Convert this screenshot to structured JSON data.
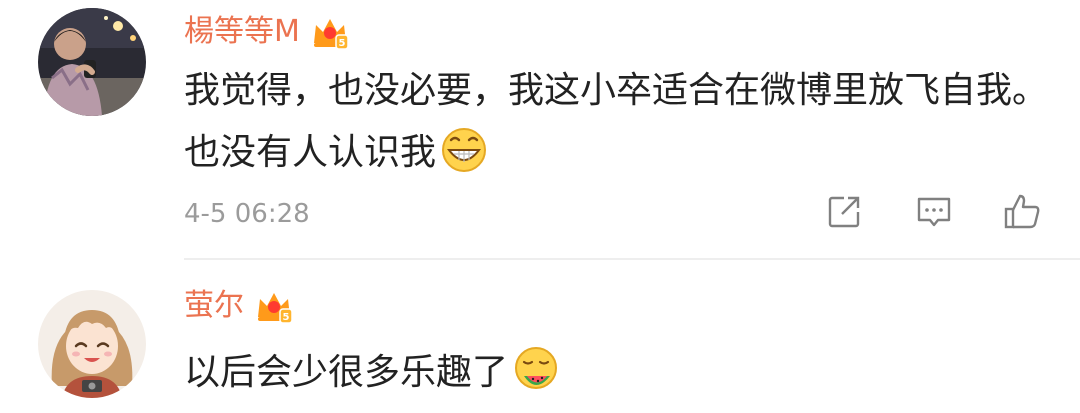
{
  "comments": [
    {
      "username": "楊等等M",
      "text": "我觉得，也没必要，我这小卒适合在微博里放飞自我。也没有人认识我",
      "emoji_icon": "grin-emoji-icon",
      "timestamp": "4-5 06:28",
      "actions": [
        "share-icon",
        "comment-icon",
        "like-icon"
      ]
    },
    {
      "username": "萤尔",
      "text": "以后会少很多乐趣了",
      "emoji_icon": "eating-watermelon-emoji-icon"
    }
  ],
  "colors": {
    "username": "#eb7350",
    "body_text": "#222222",
    "meta_text": "#9b9b9b",
    "icon_stroke": "#808080",
    "vip_crown": "#ff9a1a",
    "divider": "#eeeeee"
  }
}
